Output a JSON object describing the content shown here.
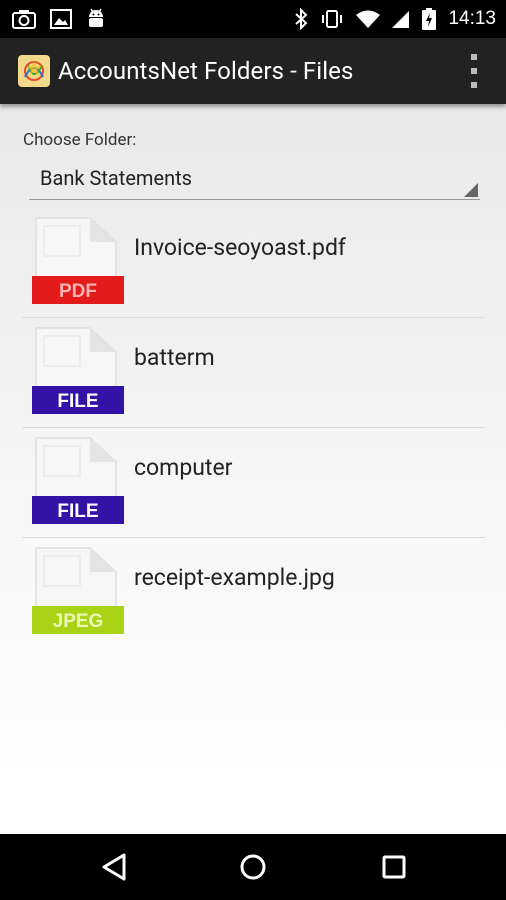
{
  "status_bar": {
    "time": "14:13",
    "left_icons": [
      "camera-icon",
      "image-icon",
      "android-icon"
    ],
    "right_icons": [
      "bluetooth-icon",
      "vibrate-icon",
      "wifi-icon",
      "signal-icon",
      "battery-icon"
    ]
  },
  "action_bar": {
    "title": "AccountsNet Folders - Files",
    "overflow": "more-options-icon"
  },
  "folder_chooser": {
    "label": "Choose Folder:",
    "selected": "Bank Statements"
  },
  "files": [
    {
      "name": "Invoice-seoyoast.pdf",
      "type_label": "PDF",
      "badge_color": "#e31b1b",
      "badge_text_color": "#ffb3b3"
    },
    {
      "name": "batterm",
      "type_label": "FILE",
      "badge_color": "#3312a6",
      "badge_text_color": "#ffffff"
    },
    {
      "name": "computer",
      "type_label": "FILE",
      "badge_color": "#3312a6",
      "badge_text_color": "#ffffff"
    },
    {
      "name": "receipt-example.jpg",
      "type_label": "JPEG",
      "badge_color": "#a9d416",
      "badge_text_color": "#eaf7b8"
    }
  ],
  "nav_bar": {
    "buttons": [
      "back-icon",
      "home-icon",
      "recents-icon"
    ]
  }
}
